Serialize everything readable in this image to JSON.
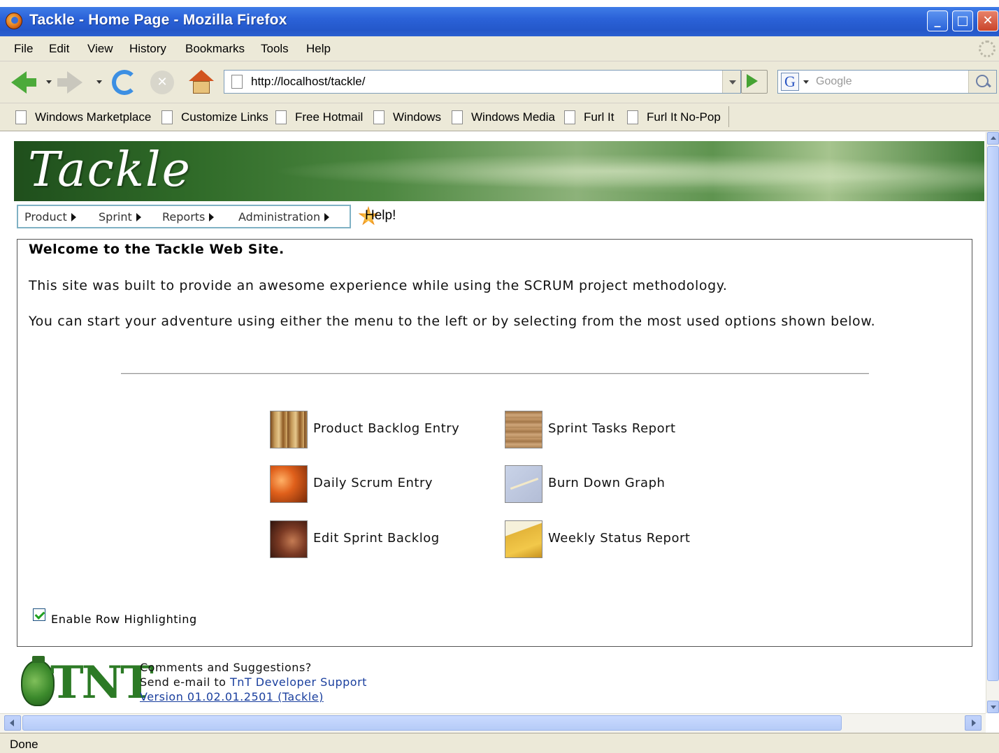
{
  "window": {
    "title": "Tackle - Home Page - Mozilla Firefox"
  },
  "menubar": {
    "items": [
      "File",
      "Edit",
      "View",
      "History",
      "Bookmarks",
      "Tools",
      "Help"
    ]
  },
  "navbar": {
    "url": "http://localhost/tackle/",
    "search_placeholder": "Google",
    "search_engine_icon": "G"
  },
  "bookmarks": [
    "Windows Marketplace",
    "Customize Links",
    "Free Hotmail",
    "Windows",
    "Windows Media",
    "Furl It",
    "Furl It No-Pop"
  ],
  "page": {
    "brand": "Tackle",
    "site_menu": [
      "Product",
      "Sprint",
      "Reports",
      "Administration"
    ],
    "help_label": "Help!",
    "welcome_heading": "Welcome to the Tackle Web Site.",
    "intro_1": "This site was built to provide an awesome experience while using the SCRUM project methodology.",
    "intro_2": "You can start your adventure using either the menu to the left or by selecting from the most used options shown below.",
    "options": [
      {
        "label": "Product Backlog Entry",
        "icon": "wood-icon"
      },
      {
        "label": "Sprint Tasks Report",
        "icon": "cork-icon"
      },
      {
        "label": "Daily Scrum Entry",
        "icon": "orange-abstract-icon"
      },
      {
        "label": "Burn Down Graph",
        "icon": "graph-icon"
      },
      {
        "label": "Edit Sprint Backlog",
        "icon": "brown-abstract-icon"
      },
      {
        "label": "Weekly Status Report",
        "icon": "notes-icon"
      }
    ],
    "row_highlighting": {
      "label": "Enable Row Highlighting",
      "checked": true
    },
    "footer": {
      "logo_text": "TNT",
      "comments": "Comments and Suggestions?",
      "send_prefix": "Send e-mail to ",
      "support_link": "TnT Developer Support",
      "version": "Version 01.02.01.2501 (Tackle)"
    }
  },
  "status": {
    "text": "Done"
  }
}
